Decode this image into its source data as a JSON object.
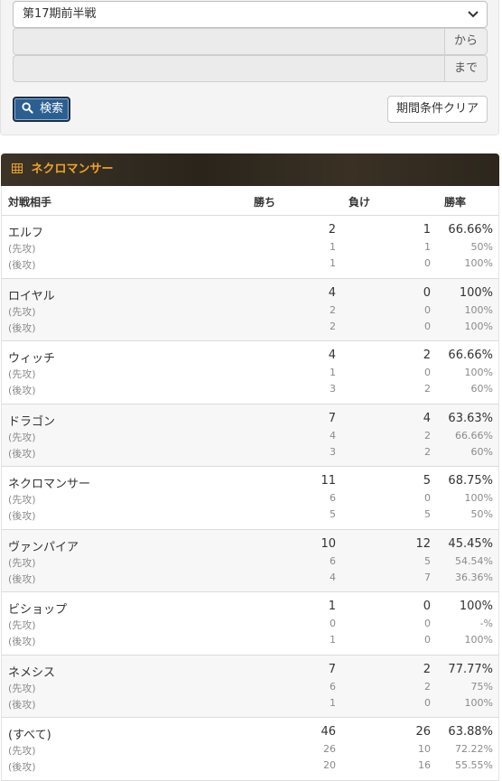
{
  "filter": {
    "season_selected": "第17期前半戦",
    "from_addon": "から",
    "to_addon": "まで",
    "search_label": "検索",
    "clear_label": "期間条件クリア"
  },
  "table": {
    "title": "ネクロマンサー",
    "columns": {
      "opponent": "対戦相手",
      "wins": "勝ち",
      "losses": "負け",
      "rate": "勝率"
    },
    "first_label": "(先攻)",
    "second_label": "(後攻)",
    "rows": [
      {
        "name": "エルフ",
        "wins": "2",
        "losses": "1",
        "rate": "66.66%",
        "first": {
          "wins": "1",
          "losses": "1",
          "rate": "50%"
        },
        "second": {
          "wins": "1",
          "losses": "0",
          "rate": "100%"
        }
      },
      {
        "name": "ロイヤル",
        "wins": "4",
        "losses": "0",
        "rate": "100%",
        "first": {
          "wins": "2",
          "losses": "0",
          "rate": "100%"
        },
        "second": {
          "wins": "2",
          "losses": "0",
          "rate": "100%"
        }
      },
      {
        "name": "ウィッチ",
        "wins": "4",
        "losses": "2",
        "rate": "66.66%",
        "first": {
          "wins": "1",
          "losses": "0",
          "rate": "100%"
        },
        "second": {
          "wins": "3",
          "losses": "2",
          "rate": "60%"
        }
      },
      {
        "name": "ドラゴン",
        "wins": "7",
        "losses": "4",
        "rate": "63.63%",
        "first": {
          "wins": "4",
          "losses": "2",
          "rate": "66.66%"
        },
        "second": {
          "wins": "3",
          "losses": "2",
          "rate": "60%"
        }
      },
      {
        "name": "ネクロマンサー",
        "wins": "11",
        "losses": "5",
        "rate": "68.75%",
        "first": {
          "wins": "6",
          "losses": "0",
          "rate": "100%"
        },
        "second": {
          "wins": "5",
          "losses": "5",
          "rate": "50%"
        }
      },
      {
        "name": "ヴァンパイア",
        "wins": "10",
        "losses": "12",
        "rate": "45.45%",
        "first": {
          "wins": "6",
          "losses": "5",
          "rate": "54.54%"
        },
        "second": {
          "wins": "4",
          "losses": "7",
          "rate": "36.36%"
        }
      },
      {
        "name": "ビショップ",
        "wins": "1",
        "losses": "0",
        "rate": "100%",
        "first": {
          "wins": "0",
          "losses": "0",
          "rate": "-%"
        },
        "second": {
          "wins": "1",
          "losses": "0",
          "rate": "100%"
        }
      },
      {
        "name": "ネメシス",
        "wins": "7",
        "losses": "2",
        "rate": "77.77%",
        "first": {
          "wins": "6",
          "losses": "2",
          "rate": "75%"
        },
        "second": {
          "wins": "1",
          "losses": "0",
          "rate": "100%"
        }
      },
      {
        "name": "(すべて)",
        "wins": "46",
        "losses": "26",
        "rate": "63.88%",
        "first": {
          "wins": "26",
          "losses": "10",
          "rate": "72.22%"
        },
        "second": {
          "wins": "20",
          "losses": "16",
          "rate": "55.55%"
        }
      }
    ]
  },
  "colors": {
    "accent": "#f0a42a",
    "button": "#2b5f92",
    "header_bg": "#2f281e"
  },
  "icons": {
    "search": "search-icon",
    "table": "grid-icon",
    "select": "chevron-down-icon"
  }
}
